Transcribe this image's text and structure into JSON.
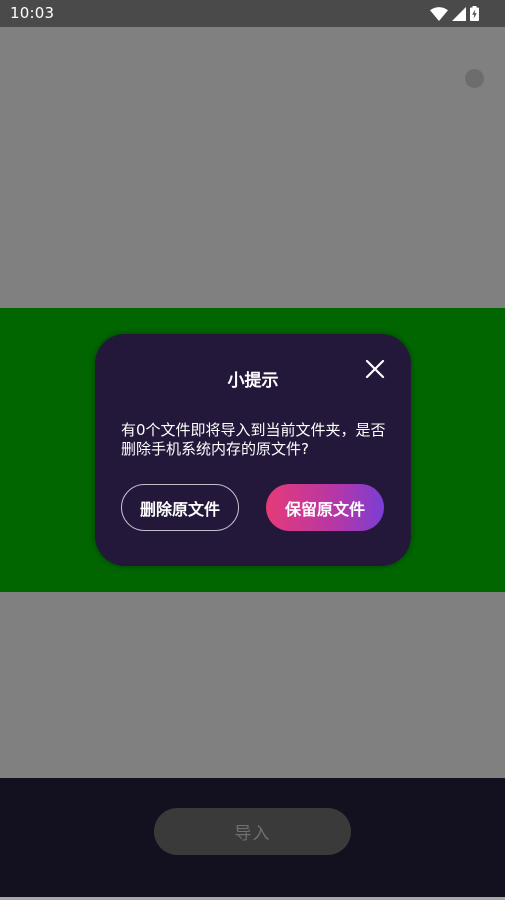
{
  "status_bar": {
    "time": "10:03",
    "icons": [
      "wifi-icon",
      "signal-icon",
      "battery-charging-icon"
    ]
  },
  "dialog": {
    "title": "小提示",
    "message": "有0个文件即将导入到当前文件夹，是否删除手机系统内存的原文件?",
    "delete_label": "删除原文件",
    "keep_label": "保留原文件",
    "close_icon": "close-icon"
  },
  "bottom_bar": {
    "import_label": "导入"
  },
  "colors": {
    "dialog_background": "#23183a",
    "green_band": "#016500",
    "keep_gradient_start": "#e63a78",
    "keep_gradient_end": "#7a3ed6"
  }
}
